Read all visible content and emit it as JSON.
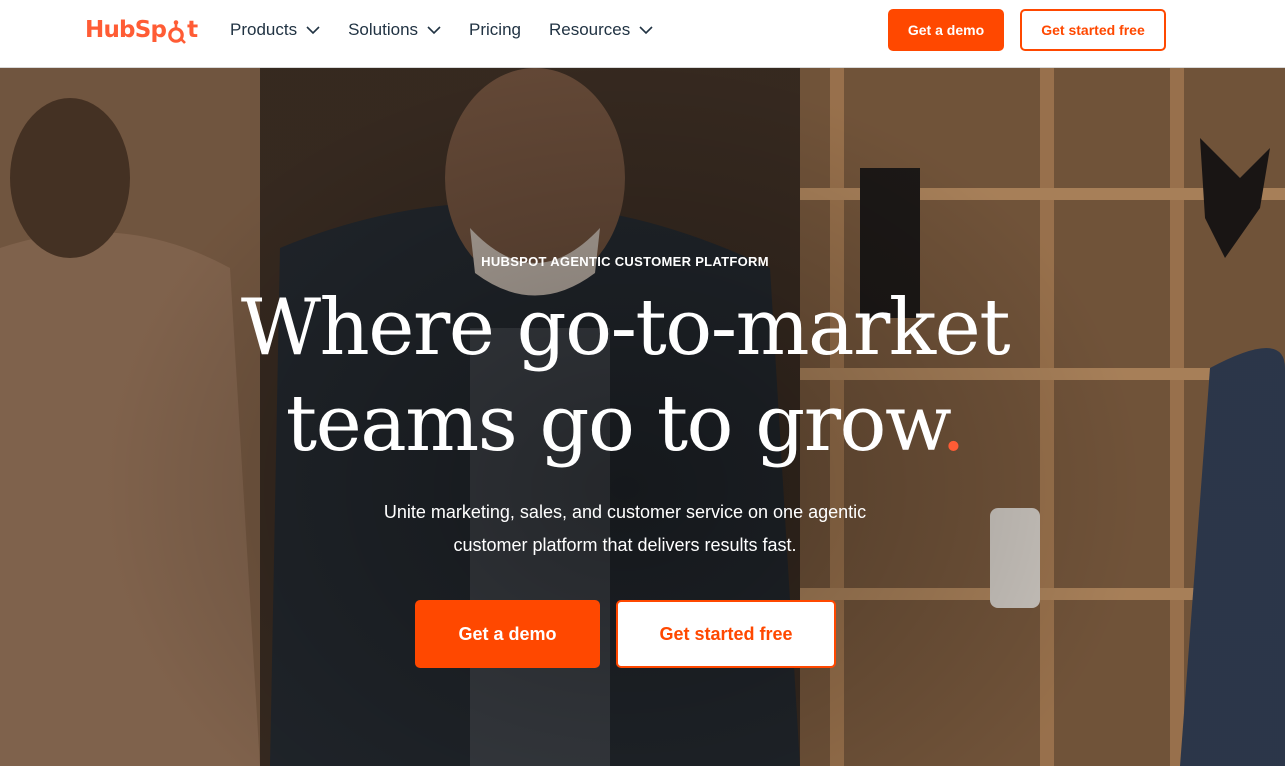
{
  "brand": {
    "name": "HubSpot",
    "accent_color": "#ff5c35",
    "cta_color": "#ff4800"
  },
  "nav": {
    "items": [
      {
        "label": "Products",
        "has_dropdown": true,
        "icon": "chevron-down-icon"
      },
      {
        "label": "Solutions",
        "has_dropdown": true,
        "icon": "chevron-down-icon"
      },
      {
        "label": "Pricing",
        "has_dropdown": false
      },
      {
        "label": "Resources",
        "has_dropdown": true,
        "icon": "chevron-down-icon"
      }
    ],
    "demo_label": "Get a demo",
    "free_label": "Get started free"
  },
  "hero": {
    "eyebrow": "HUBSPOT AGENTIC CUSTOMER PLATFORM",
    "headline_line1": "Where go-to-market",
    "headline_line2": "teams go to grow",
    "headline_dot": ".",
    "subhead_line1": "Unite marketing, sales, and customer service on one agentic",
    "subhead_line2": "customer platform that delivers results fast.",
    "cta_demo_label": "Get a demo",
    "cta_free_label": "Get started free"
  }
}
